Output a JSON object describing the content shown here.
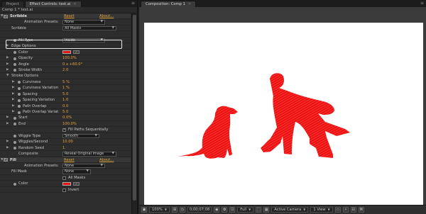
{
  "left_panel": {
    "tabs": [
      {
        "label": "Project",
        "active": false
      },
      {
        "label": "Effect Controls: test.ai",
        "active": true
      }
    ],
    "menu_icon": "panel-menu-icon",
    "breadcrumb": "Comp 1 * test.ai",
    "scribble": {
      "section_label": "Scribble",
      "reset_label": "Reset",
      "about_label": "About...",
      "presets_label": "Animation Presets:",
      "presets_value": "None",
      "scribble_label": "Scribble",
      "scribble_value": "All Masks",
      "fill_type_label": "Fill Type",
      "fill_type_value": "Inside",
      "edge_options_label": "Edge Options",
      "color_label": "Color",
      "color_value": "#ee1111",
      "opacity_label": "Opacity",
      "opacity_value": "100.0%",
      "angle_label": "Angle",
      "angle_value": "0 x +60.0°",
      "stroke_width_label": "Stroke Width",
      "stroke_width_value": "2.0",
      "stroke_options_label": "Stroke Options",
      "curviness_label": "Curviness",
      "curviness_value": "5 %",
      "curviness_variation_label": "Curviness Variation",
      "curviness_variation_value": "1 %",
      "spacing_label": "Spacing",
      "spacing_value": "5.0",
      "spacing_variation_label": "Spacing Variation",
      "spacing_variation_value": "1.0",
      "path_overlap_label": "Path Overlap",
      "path_overlap_value": "0.0",
      "path_overlap_variation_label": "Path Overlap Variat",
      "path_overlap_variation_value": "5.0",
      "start_label": "Start",
      "start_value": "0.0%",
      "end_label": "End",
      "end_value": "100.0%",
      "fill_paths_label": "Fill Paths Sequentially",
      "wiggle_type_label": "Wiggle Type",
      "wiggle_type_value": "Smooth",
      "wiggles_label": "Wiggles/Second",
      "wiggles_value": "10.00",
      "random_seed_label": "Random Seed",
      "random_seed_value": "1",
      "composite_label": "Composite",
      "composite_value": "Reveal Original Image"
    },
    "fill": {
      "section_label": "Fill",
      "reset_label": "Reset",
      "about_label": "About...",
      "presets_label": "Animation Presets:",
      "presets_value": "None",
      "fill_mask_label": "Fill Mask",
      "fill_mask_value": "None",
      "all_masks_label": "All Masks",
      "color_label": "Color",
      "color_value": "#ee1111",
      "invert_label": "Invert"
    }
  },
  "right_panel": {
    "tab_label": "Composition: Comp 1",
    "bottom_bar": {
      "zoom": "100%",
      "timecode": "0;00;07;08",
      "resolution": "Full",
      "camera": "Active Camera",
      "view": "1 View"
    }
  },
  "colors": {
    "accent_value": "#e0a63a",
    "scribble_red": "#ee1111"
  }
}
